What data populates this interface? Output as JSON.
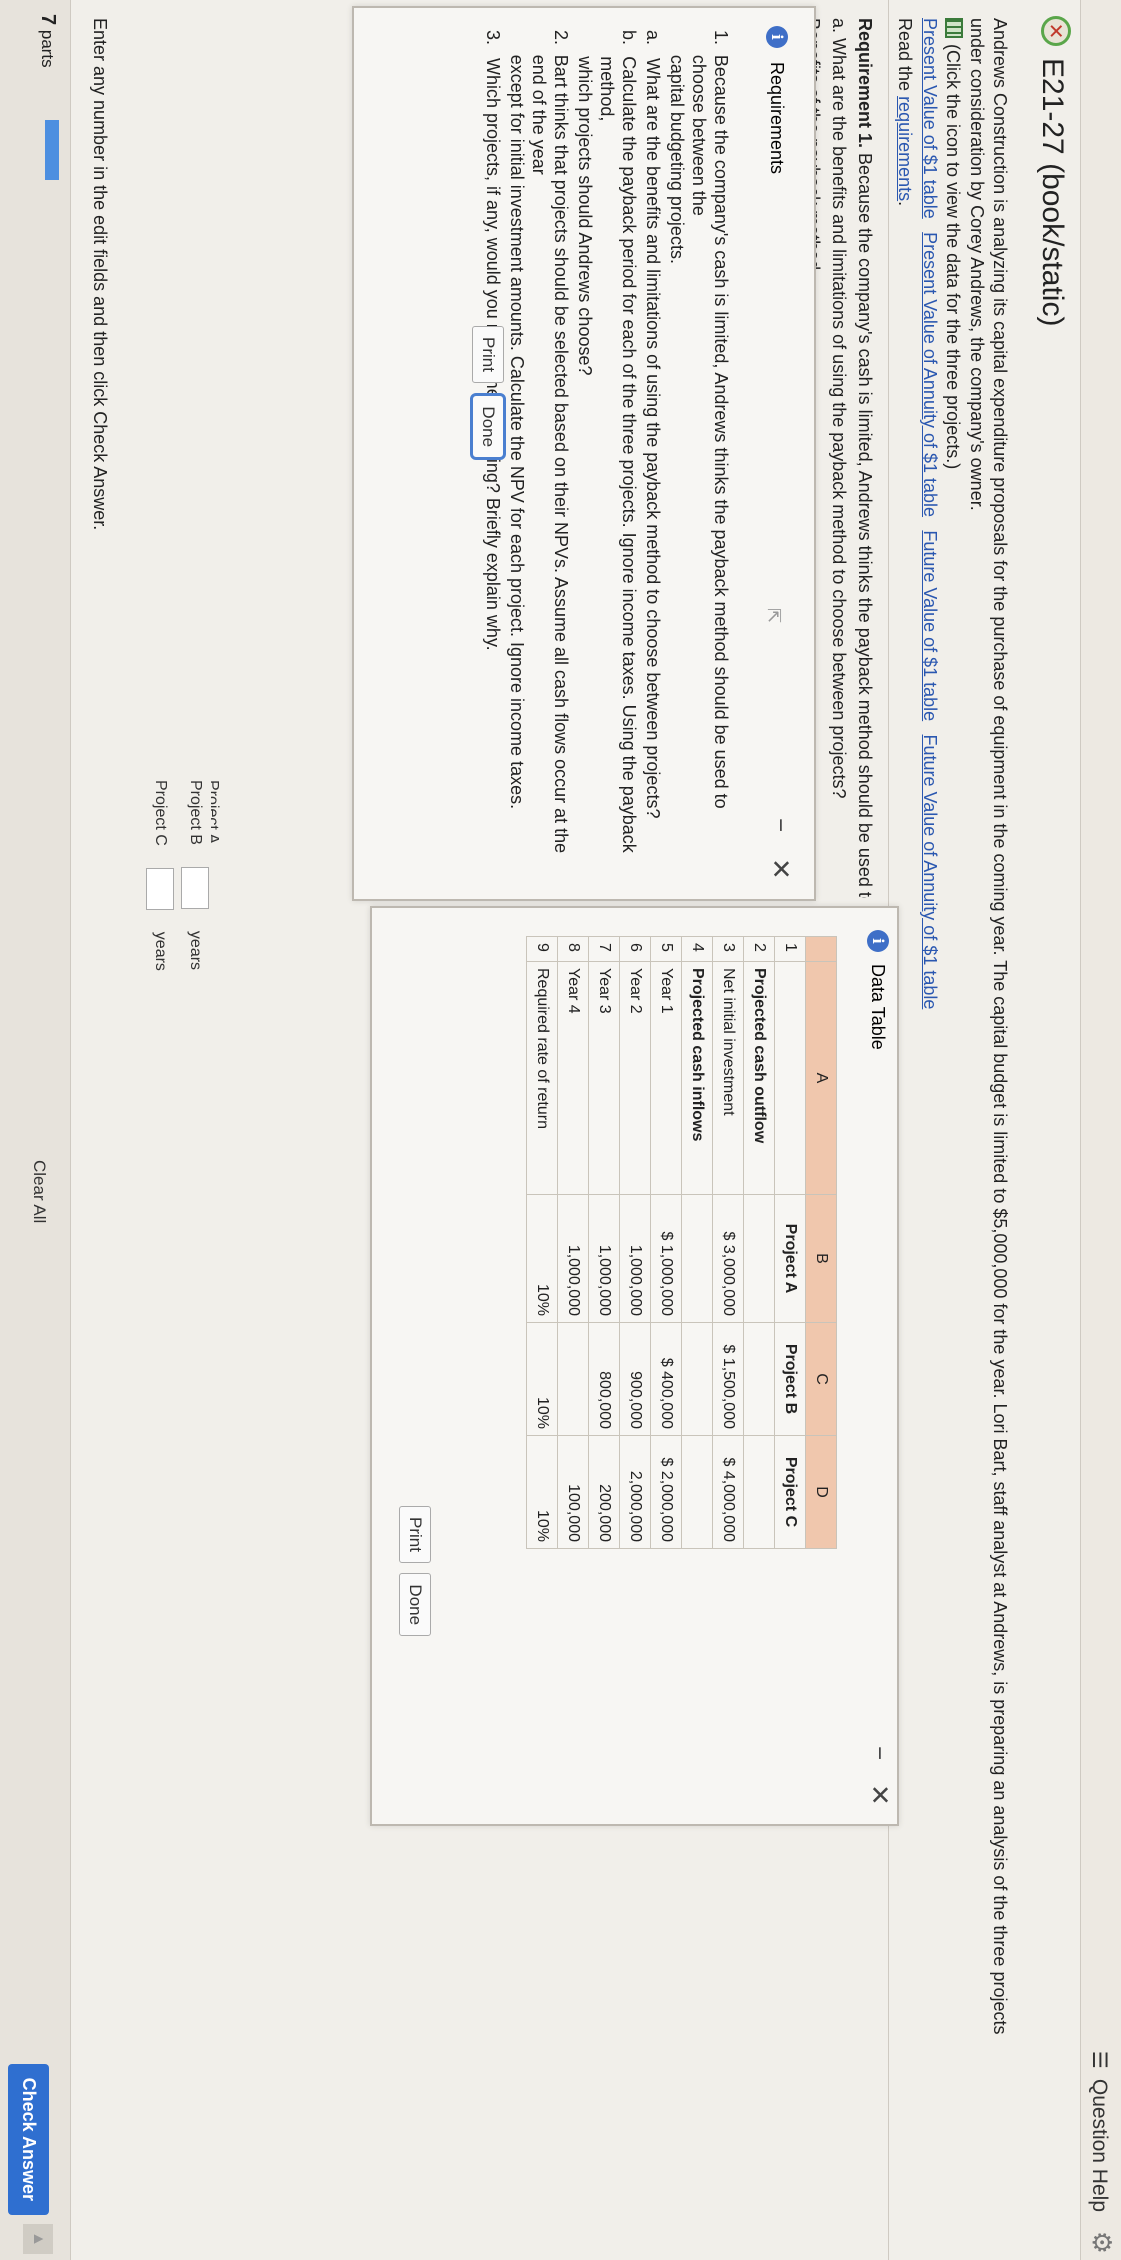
{
  "header": {
    "question_help": "Question Help"
  },
  "title": "E21-27 (book/static)",
  "problem": {
    "intro_line1": "Andrews Construction is analyzing its capital expenditure proposals for the purchase of equipment in the coming year. The capital budget is limited to $5,000,000 for the year. Lori Bart, staff analyst at Andrews, is preparing an analysis of the three projects",
    "intro_line2": "under consideration by Corey Andrews, the company's owner.",
    "data_hint": "(Click the icon to view the data for the three projects.)",
    "links": [
      "Present Value of $1 table",
      "Present Value of Annuity of $1 table",
      "Future Value of $1 table",
      "Future Value of Annuity of $1 table"
    ],
    "read_prefix": "Read the ",
    "read_link": "requirements",
    "read_suffix": ".",
    "requirement_heading": "Requirement 1.",
    "requirement_text": " Because the company's cash is limited, Andrews thinks the payback method should be used to choose between t",
    "question_a": "a. What are the benefits and limitations of using the payback method to choose between projects?",
    "partial_line": "Benefits of the payback method"
  },
  "requirements_dialog": {
    "title": "Requirements",
    "items": [
      {
        "num": "1.",
        "text1": "Because the company's cash is limited, Andrews thinks the payback method should be used to choose between the",
        "text2": "capital budgeting projects."
      },
      {
        "num": "a.",
        "text1": "What are the benefits and limitations of using the payback method to choose between projects?",
        "text2": ""
      },
      {
        "num": "b.",
        "text1": "Calculate the payback period for each of the three projects. Ignore income taxes. Using the payback method,",
        "text2": "which projects should Andrews choose?"
      },
      {
        "num": "2.",
        "text1": "Bart thinks that projects should be selected based on their NPVs. Assume all cash flows occur at the end of the year",
        "text2": "except for initial investment amounts. Calculate the NPV for each project. Ignore income taxes."
      },
      {
        "num": "3.",
        "text1": "Which projects, if any, would you recommend funding? Briefly explain why.",
        "text2": ""
      }
    ],
    "print": "Print",
    "done": "Done",
    "minimize": "−",
    "close": "✕"
  },
  "data_dialog": {
    "title": "Data Table",
    "columns": [
      "",
      "A",
      "B",
      "C",
      "D"
    ],
    "rows": [
      {
        "n": "1",
        "a": "",
        "b": "Project A",
        "c": "Project B",
        "d": "Project C",
        "bold": true
      },
      {
        "n": "2",
        "a": "Projected cash outflow",
        "b": "",
        "c": "",
        "d": "",
        "bold": true
      },
      {
        "n": "3",
        "a": "Net initial investment",
        "b": "$ 3,000,000",
        "c": "$ 1,500,000",
        "d": "$ 4,000,000",
        "bold": false
      },
      {
        "n": "4",
        "a": "Projected cash inflows",
        "b": "",
        "c": "",
        "d": "",
        "bold": true
      },
      {
        "n": "5",
        "a": "Year 1",
        "b": "$ 1,000,000",
        "c": "$ 400,000",
        "d": "$ 2,000,000",
        "bold": false
      },
      {
        "n": "6",
        "a": "Year 2",
        "b": "1,000,000",
        "c": "900,000",
        "d": "2,000,000",
        "bold": false
      },
      {
        "n": "7",
        "a": "Year 3",
        "b": "1,000,000",
        "c": "800,000",
        "d": "200,000",
        "bold": false
      },
      {
        "n": "8",
        "a": "Year 4",
        "b": "1,000,000",
        "c": "",
        "d": "100,000",
        "bold": false
      },
      {
        "n": "9",
        "a": "Required rate of return",
        "b": "10%",
        "c": "10%",
        "d": "10%",
        "bold": false
      }
    ],
    "print": "Print",
    "done": "Done",
    "minimize": "−",
    "close": "✕"
  },
  "payback": {
    "header_col": "Project A",
    "header_years": "years",
    "rows": [
      {
        "label": "Project B",
        "unit": "years"
      },
      {
        "label": "Project C",
        "unit": "years"
      }
    ]
  },
  "footer": {
    "instruction": "Enter any number in the edit fields and then click Check Answer.",
    "parts_count": "7",
    "parts_label": "parts",
    "clear_all": "Clear All",
    "check_answer": "Check Answer"
  }
}
